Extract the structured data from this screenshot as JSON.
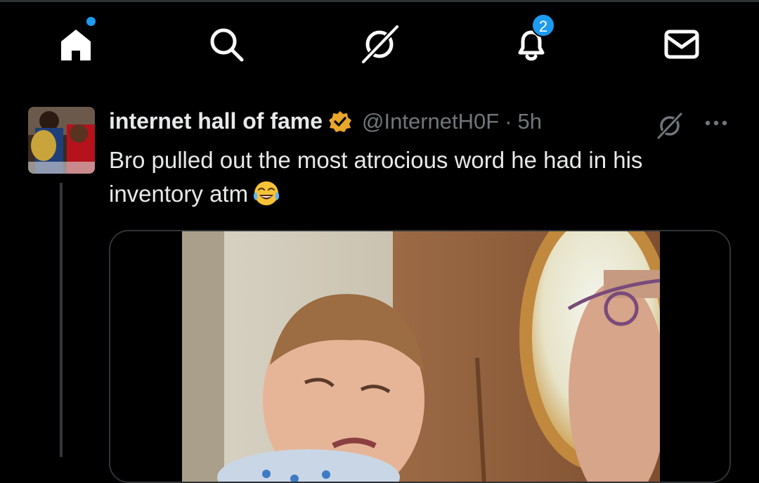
{
  "nav": {
    "items": [
      {
        "name": "home",
        "icon": "home-icon",
        "has_dot": true
      },
      {
        "name": "search",
        "icon": "search-icon"
      },
      {
        "name": "grok",
        "icon": "grok-icon"
      },
      {
        "name": "notifications",
        "icon": "bell-icon",
        "badge": "2"
      },
      {
        "name": "messages",
        "icon": "mail-icon"
      }
    ],
    "notifications_badge": "2",
    "accent_color": "#1d9bf0"
  },
  "post": {
    "display_name": "internet hall of fame",
    "verified": true,
    "verified_color": "#e8a62b",
    "handle": "@InternetH0F",
    "separator": "·",
    "timestamp": "5h",
    "text": "Bro pulled out the most atrocious word he had in his inventory atm",
    "emoji": "face-with-tears-of-joy",
    "media": {
      "type": "video-thumbnail"
    }
  }
}
